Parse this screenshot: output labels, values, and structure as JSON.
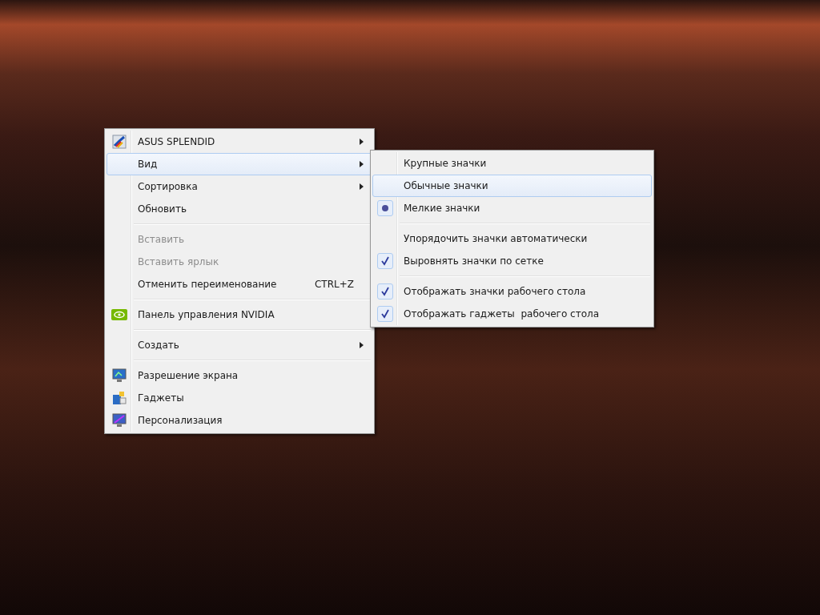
{
  "context_menu": {
    "items": [
      {
        "kind": "command",
        "label": "ASUS SPLENDID",
        "selected": false,
        "disabled": false,
        "submenu": true
      },
      {
        "kind": "command",
        "label": "Вид",
        "selected": true,
        "disabled": false,
        "submenu": true
      },
      {
        "kind": "command",
        "label": "Сортировка",
        "selected": false,
        "disabled": false,
        "submenu": true
      },
      {
        "kind": "command",
        "label": "Обновить",
        "selected": false,
        "disabled": false,
        "submenu": false
      },
      {
        "kind": "separator"
      },
      {
        "kind": "command",
        "label": "Вставить",
        "selected": false,
        "disabled": true,
        "submenu": false
      },
      {
        "kind": "command",
        "label": "Вставить ярлык",
        "selected": false,
        "disabled": true,
        "submenu": false
      },
      {
        "kind": "command",
        "label": "Отменить переименование",
        "shortcut": "CTRL+Z",
        "selected": false,
        "disabled": false,
        "submenu": false
      },
      {
        "kind": "separator"
      },
      {
        "kind": "command",
        "label": "Панель управления NVIDIA",
        "selected": false,
        "disabled": false,
        "submenu": false
      },
      {
        "kind": "separator"
      },
      {
        "kind": "command",
        "label": "Создать",
        "selected": false,
        "disabled": false,
        "submenu": true
      },
      {
        "kind": "separator"
      },
      {
        "kind": "command",
        "label": "Разрешение экрана",
        "selected": false,
        "disabled": false,
        "submenu": false
      },
      {
        "kind": "command",
        "label": "Гаджеты",
        "selected": false,
        "disabled": false,
        "submenu": false
      },
      {
        "kind": "command",
        "label": "Персонализация",
        "selected": false,
        "disabled": false,
        "submenu": false
      }
    ]
  },
  "view_submenu": {
    "items": [
      {
        "kind": "radio",
        "label": "Крупные значки",
        "selected": false,
        "checked": false
      },
      {
        "kind": "radio",
        "label": "Обычные значки",
        "selected": true,
        "checked": false
      },
      {
        "kind": "radio",
        "label": "Мелкие значки",
        "selected": false,
        "checked": true
      },
      {
        "kind": "separator"
      },
      {
        "kind": "check",
        "label": "Упорядочить значки автоматически",
        "selected": false,
        "checked": false
      },
      {
        "kind": "check",
        "label": "Выровнять значки по сетке",
        "selected": false,
        "checked": true
      },
      {
        "kind": "separator"
      },
      {
        "kind": "check",
        "label": "Отображать значки рабочего стола",
        "selected": false,
        "checked": true
      },
      {
        "kind": "check",
        "label": "Отображать гаджеты  рабочего стола",
        "selected": false,
        "checked": true
      }
    ]
  }
}
